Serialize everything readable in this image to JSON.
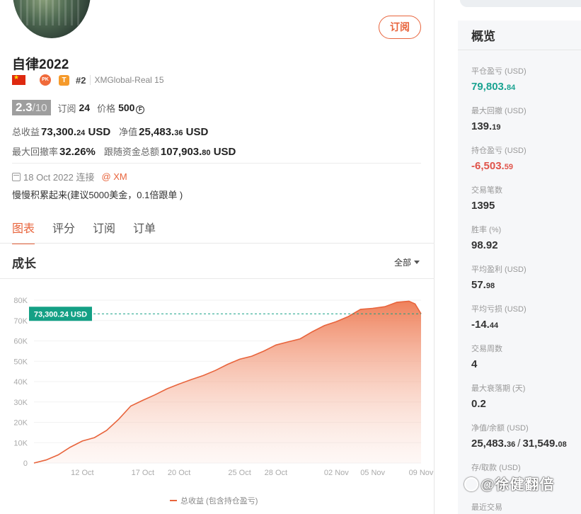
{
  "profile": {
    "name": "自律2022",
    "subscribe_label": "订阅",
    "pk_label": "PK",
    "tier_label": "T",
    "rank": "#2",
    "broker": "XMGlobal-Real 15",
    "score": "2.3",
    "score_max": "/10",
    "subs_label": "订阅",
    "subs_value": "24",
    "price_label": "价格",
    "price_value": "500",
    "coin_symbol": "F",
    "total_profit_label": "总收益",
    "total_profit_main": "73,300.",
    "total_profit_dec": "24",
    "total_profit_unit": " USD",
    "equity_label": "净值",
    "equity_main": "25,483.",
    "equity_dec": "36",
    "equity_unit": " USD",
    "max_dd_label": "最大回撤率",
    "max_dd_value": "32.26%",
    "follow_funds_label": "跟随资金总额",
    "follow_funds_main": "107,903.",
    "follow_funds_dec": "80",
    "follow_funds_unit": " USD",
    "joined": "18 Oct 2022 连接",
    "broker_link": "@ XM",
    "description": "慢慢积累起来(建议5000美金，0.1倍跟单 )"
  },
  "tabs": [
    {
      "label": "图表",
      "active": true
    },
    {
      "label": "评分",
      "active": false
    },
    {
      "label": "订阅",
      "active": false
    },
    {
      "label": "订单",
      "active": false
    }
  ],
  "chart_section": {
    "title": "成长",
    "range_label": "全部"
  },
  "chart_data": {
    "type": "area",
    "ylabel": "",
    "xlabel": "",
    "ylim": [
      0,
      80000
    ],
    "y_ticks": [
      "0",
      "10K",
      "20K",
      "30K",
      "40K",
      "50K",
      "60K",
      "70K",
      "80K"
    ],
    "x_ticks": [
      {
        "label": "12 Oct",
        "x": 4
      },
      {
        "label": "17 Oct",
        "x": 9
      },
      {
        "label": "20 Oct",
        "x": 12
      },
      {
        "label": "25 Oct",
        "x": 17
      },
      {
        "label": "28 Oct",
        "x": 20
      },
      {
        "label": "02 Nov",
        "x": 25
      },
      {
        "label": "05 Nov",
        "x": 28
      },
      {
        "label": "09 Nov",
        "x": 32
      }
    ],
    "x_range": [
      0,
      32
    ],
    "series": [
      {
        "name": "总收益 (包含持仓盈亏)",
        "color": "#e8643c",
        "points": [
          [
            0.0,
            0
          ],
          [
            1.0,
            1500
          ],
          [
            2.0,
            4000
          ],
          [
            3.0,
            7800
          ],
          [
            4.0,
            10800
          ],
          [
            5.0,
            12500
          ],
          [
            6.0,
            16000
          ],
          [
            7.0,
            21500
          ],
          [
            8.0,
            28000
          ],
          [
            9.0,
            30800
          ],
          [
            10.0,
            33500
          ],
          [
            11.0,
            36500
          ],
          [
            12.0,
            38800
          ],
          [
            13.0,
            41000
          ],
          [
            14.0,
            43000
          ],
          [
            15.0,
            45500
          ],
          [
            16.0,
            48500
          ],
          [
            17.0,
            51000
          ],
          [
            18.0,
            52500
          ],
          [
            19.0,
            55000
          ],
          [
            20.0,
            58000
          ],
          [
            21.0,
            59500
          ],
          [
            22.0,
            61000
          ],
          [
            23.0,
            64500
          ],
          [
            24.0,
            67500
          ],
          [
            25.0,
            69500
          ],
          [
            26.0,
            72000
          ],
          [
            27.0,
            75500
          ],
          [
            28.0,
            76000
          ],
          [
            29.0,
            76800
          ],
          [
            30.0,
            79000
          ],
          [
            31.0,
            79500
          ],
          [
            31.5,
            78200
          ],
          [
            32.0,
            73300.24
          ]
        ]
      }
    ],
    "marker": {
      "label": "73,300.24 USD",
      "value": 73300.24,
      "color": "#14a085"
    },
    "legend": "总收益 (包含持仓盈亏)"
  },
  "overview": {
    "title": "概览",
    "metrics": [
      {
        "label": "平仓盈亏 (USD)",
        "main": "79,803.",
        "dec": "84",
        "style": "green"
      },
      {
        "label": "最大回撤 (USD)",
        "main": "139.",
        "dec": "19",
        "style": ""
      },
      {
        "label": "持仓盈亏 (USD)",
        "main": "-6,503.",
        "dec": "59",
        "style": "red"
      },
      {
        "label": "交易笔数",
        "main": "1395",
        "dec": "",
        "style": ""
      },
      {
        "label": "胜率 (%)",
        "main": "98.92",
        "dec": "",
        "style": ""
      },
      {
        "label": "平均盈利 (USD)",
        "main": "57.",
        "dec": "98",
        "style": ""
      },
      {
        "label": "平均亏损 (USD)",
        "main": "-14.",
        "dec": "44",
        "style": ""
      },
      {
        "label": "交易周数",
        "main": "4",
        "dec": "",
        "style": ""
      },
      {
        "label": "最大衰落期 (天)",
        "main": "0.2",
        "dec": "",
        "style": ""
      },
      {
        "label": "净值/余额 (USD)",
        "main": "25,483.",
        "dec": "36",
        "main2": "31,549.",
        "dec2": "08",
        "style": ""
      },
      {
        "label": "存/取款 (USD)",
        "main": "",
        "dec": "",
        "style": ""
      },
      {
        "label": "最近交易",
        "main": "",
        "dec": "",
        "style": ""
      }
    ]
  },
  "watermark": "@徐健翻倍"
}
